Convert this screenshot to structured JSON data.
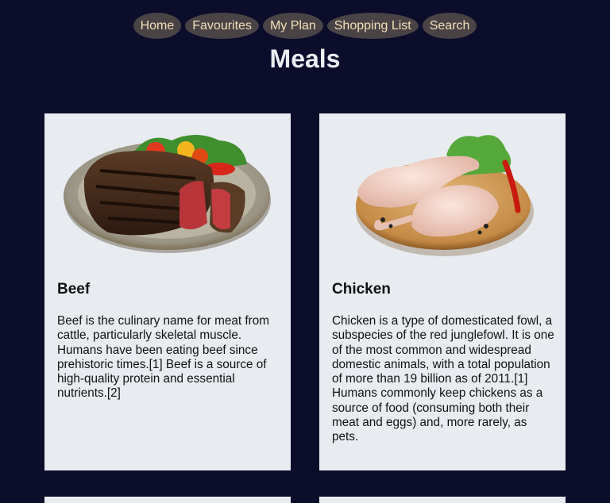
{
  "nav": {
    "items": [
      {
        "label": "Home"
      },
      {
        "label": "Favourites"
      },
      {
        "label": "My Plan"
      },
      {
        "label": "Shopping List"
      },
      {
        "label": "Search"
      }
    ]
  },
  "page": {
    "title": "Meals"
  },
  "meals": [
    {
      "title": "Beef",
      "description": "Beef is the culinary name for meat from cattle, particularly skeletal muscle. Humans have been eating beef since prehistoric times.[1] Beef is a source of high-quality protein and essential nutrients.[2]"
    },
    {
      "title": "Chicken",
      "description": "Chicken is a type of domesticated fowl, a subspecies of the red junglefowl. It is one of the most common and widespread domestic animals, with a total population of more than 19 billion as of 2011.[1] Humans commonly keep chickens as a source of food (consuming both their meat and eggs) and, more rarely, as pets."
    }
  ],
  "colors": {
    "background": "#0b0d2b",
    "nav_pill": "#4a4346",
    "nav_text": "#f0e0b6",
    "card": "#e8ebef"
  }
}
